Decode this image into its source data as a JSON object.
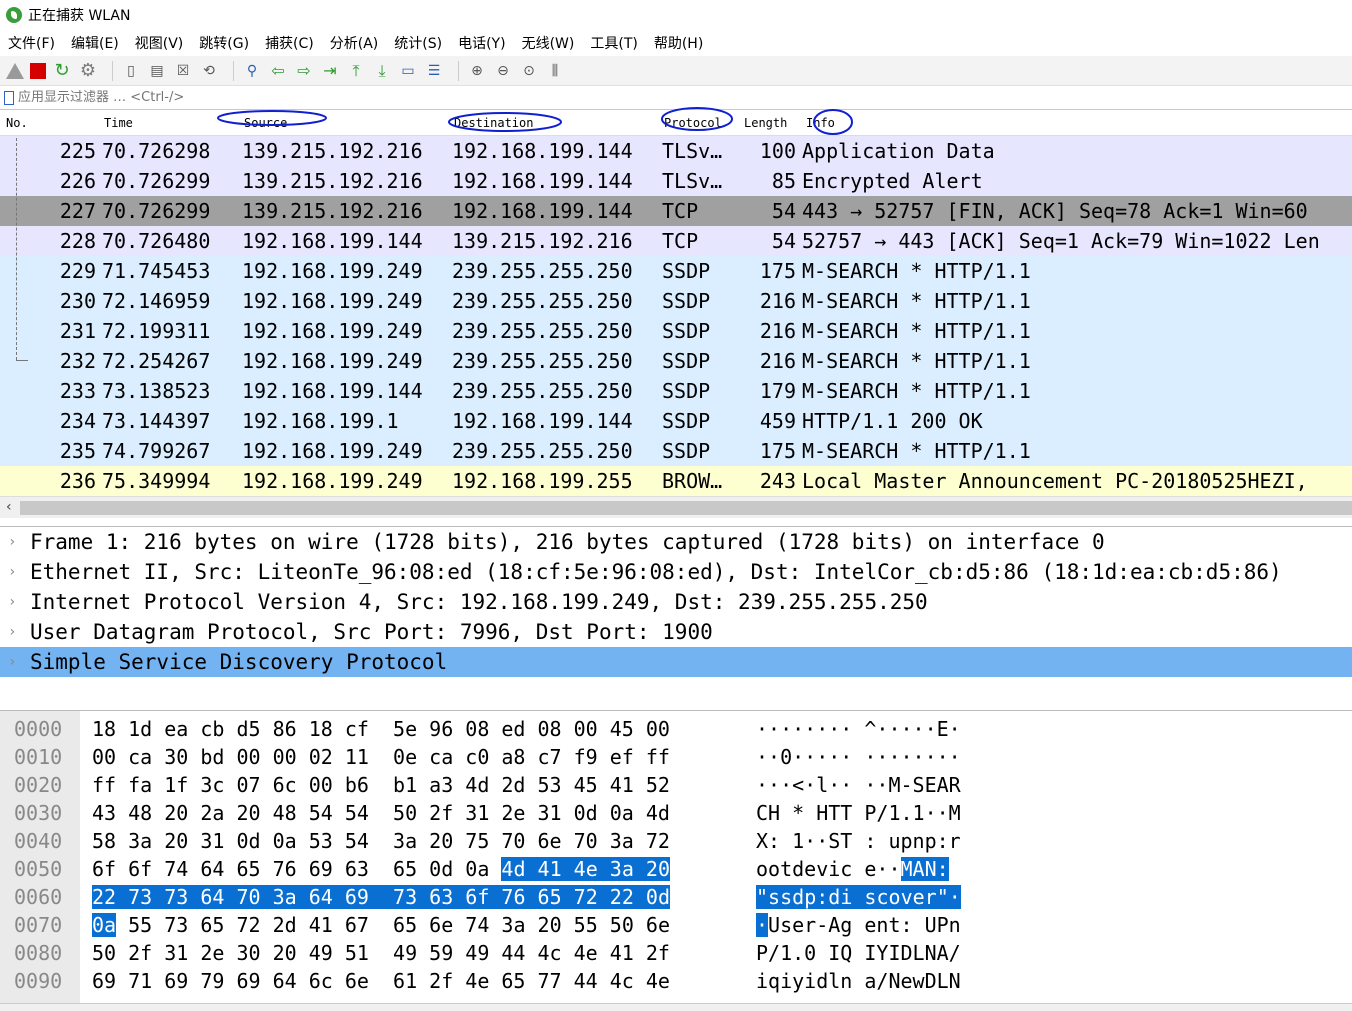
{
  "window": {
    "title": "正在捕获 WLAN"
  },
  "menu": [
    "文件(F)",
    "编辑(E)",
    "视图(V)",
    "跳转(G)",
    "捕获(C)",
    "分析(A)",
    "统计(S)",
    "电话(Y)",
    "无线(W)",
    "工具(T)",
    "帮助(H)"
  ],
  "filter": {
    "placeholder": "应用显示过滤器 … <Ctrl-/>"
  },
  "columns": {
    "no": "No.",
    "time": "Time",
    "source": "Source",
    "destination": "Destination",
    "protocol": "Protocol",
    "length": "Length",
    "info": "Info"
  },
  "packets": [
    {
      "no": "225",
      "time": "70.726298",
      "src": "139.215.192.216",
      "dst": "192.168.199.144",
      "proto": "TLSv…",
      "len": "100",
      "info": "Application Data",
      "bg": "#e7e6ff"
    },
    {
      "no": "226",
      "time": "70.726299",
      "src": "139.215.192.216",
      "dst": "192.168.199.144",
      "proto": "TLSv…",
      "len": "85",
      "info": "Encrypted Alert",
      "bg": "#e7e6ff"
    },
    {
      "no": "227",
      "time": "70.726299",
      "src": "139.215.192.216",
      "dst": "192.168.199.144",
      "proto": "TCP",
      "len": "54",
      "info": "443 → 52757 [FIN, ACK] Seq=78 Ack=1 Win=60",
      "bg": "#a0a0a0"
    },
    {
      "no": "228",
      "time": "70.726480",
      "src": "192.168.199.144",
      "dst": "139.215.192.216",
      "proto": "TCP",
      "len": "54",
      "info": "52757 → 443 [ACK] Seq=1 Ack=79 Win=1022 Len",
      "bg": "#e7e6ff"
    },
    {
      "no": "229",
      "time": "71.745453",
      "src": "192.168.199.249",
      "dst": "239.255.255.250",
      "proto": "SSDP",
      "len": "175",
      "info": "M-SEARCH * HTTP/1.1",
      "bg": "#daeeff"
    },
    {
      "no": "230",
      "time": "72.146959",
      "src": "192.168.199.249",
      "dst": "239.255.255.250",
      "proto": "SSDP",
      "len": "216",
      "info": "M-SEARCH * HTTP/1.1",
      "bg": "#daeeff"
    },
    {
      "no": "231",
      "time": "72.199311",
      "src": "192.168.199.249",
      "dst": "239.255.255.250",
      "proto": "SSDP",
      "len": "216",
      "info": "M-SEARCH * HTTP/1.1",
      "bg": "#daeeff"
    },
    {
      "no": "232",
      "time": "72.254267",
      "src": "192.168.199.249",
      "dst": "239.255.255.250",
      "proto": "SSDP",
      "len": "216",
      "info": "M-SEARCH * HTTP/1.1",
      "bg": "#daeeff"
    },
    {
      "no": "233",
      "time": "73.138523",
      "src": "192.168.199.144",
      "dst": "239.255.255.250",
      "proto": "SSDP",
      "len": "179",
      "info": "M-SEARCH * HTTP/1.1",
      "bg": "#daeeff"
    },
    {
      "no": "234",
      "time": "73.144397",
      "src": "192.168.199.1",
      "dst": "192.168.199.144",
      "proto": "SSDP",
      "len": "459",
      "info": "HTTP/1.1 200 OK",
      "bg": "#daeeff"
    },
    {
      "no": "235",
      "time": "74.799267",
      "src": "192.168.199.249",
      "dst": "239.255.255.250",
      "proto": "SSDP",
      "len": "175",
      "info": "M-SEARCH * HTTP/1.1",
      "bg": "#daeeff"
    },
    {
      "no": "236",
      "time": "75.349994",
      "src": "192.168.199.249",
      "dst": "192.168.199.255",
      "proto": "BROW…",
      "len": "243",
      "info": "Local Master Announcement PC-20180525HEZI,",
      "bg": "#feffd0"
    }
  ],
  "details": [
    {
      "text": "Frame 1: 216 bytes on wire (1728 bits), 216 bytes captured (1728 bits) on interface 0",
      "selected": false
    },
    {
      "text": "Ethernet II, Src: LiteonTe_96:08:ed (18:cf:5e:96:08:ed), Dst: IntelCor_cb:d5:86 (18:1d:ea:cb:d5:86)",
      "selected": false
    },
    {
      "text": "Internet Protocol Version 4, Src: 192.168.199.249, Dst: 239.255.255.250",
      "selected": false
    },
    {
      "text": "User Datagram Protocol, Src Port: 7996, Dst Port: 1900",
      "selected": false
    },
    {
      "text": "Simple Service Discovery Protocol",
      "selected": true
    }
  ],
  "bytes": [
    {
      "off": "0000",
      "hex": [
        "18",
        "1d",
        "ea",
        "cb",
        "d5",
        "86",
        "18",
        "cf",
        "5e",
        "96",
        "08",
        "ed",
        "08",
        "00",
        "45",
        "00"
      ],
      "ascii": "········ ^·····E·"
    },
    {
      "off": "0010",
      "hex": [
        "00",
        "ca",
        "30",
        "bd",
        "00",
        "00",
        "02",
        "11",
        "0e",
        "ca",
        "c0",
        "a8",
        "c7",
        "f9",
        "ef",
        "ff"
      ],
      "ascii": "··0····· ········"
    },
    {
      "off": "0020",
      "hex": [
        "ff",
        "fa",
        "1f",
        "3c",
        "07",
        "6c",
        "00",
        "b6",
        "b1",
        "a3",
        "4d",
        "2d",
        "53",
        "45",
        "41",
        "52"
      ],
      "ascii": "···<·l·· ··M-SEAR"
    },
    {
      "off": "0030",
      "hex": [
        "43",
        "48",
        "20",
        "2a",
        "20",
        "48",
        "54",
        "54",
        "50",
        "2f",
        "31",
        "2e",
        "31",
        "0d",
        "0a",
        "4d"
      ],
      "ascii": "CH * HTT P/1.1··M"
    },
    {
      "off": "0040",
      "hex": [
        "58",
        "3a",
        "20",
        "31",
        "0d",
        "0a",
        "53",
        "54",
        "3a",
        "20",
        "75",
        "70",
        "6e",
        "70",
        "3a",
        "72"
      ],
      "ascii": "X: 1··ST : upnp:r"
    },
    {
      "off": "0050",
      "hex": [
        "6f",
        "6f",
        "74",
        "64",
        "65",
        "76",
        "69",
        "63",
        "65",
        "0d",
        "0a",
        "4d",
        "41",
        "4e",
        "3a",
        "20"
      ],
      "ascii": "ootdevic e··MAN: "
    },
    {
      "off": "0060",
      "hex": [
        "22",
        "73",
        "73",
        "64",
        "70",
        "3a",
        "64",
        "69",
        "73",
        "63",
        "6f",
        "76",
        "65",
        "72",
        "22",
        "0d"
      ],
      "ascii": "\"ssdp:di scover\"·"
    },
    {
      "off": "0070",
      "hex": [
        "0a",
        "55",
        "73",
        "65",
        "72",
        "2d",
        "41",
        "67",
        "65",
        "6e",
        "74",
        "3a",
        "20",
        "55",
        "50",
        "6e"
      ],
      "ascii": "·User-Ag ent: UPn"
    },
    {
      "off": "0080",
      "hex": [
        "50",
        "2f",
        "31",
        "2e",
        "30",
        "20",
        "49",
        "51",
        "49",
        "59",
        "49",
        "44",
        "4c",
        "4e",
        "41",
        "2f"
      ],
      "ascii": "P/1.0 IQ IYIDLNA/"
    },
    {
      "off": "0090",
      "hex": [
        "69",
        "71",
        "69",
        "79",
        "69",
        "64",
        "6c",
        "6e",
        "61",
        "2f",
        "4e",
        "65",
        "77",
        "44",
        "4c",
        "4e"
      ],
      "ascii": "iqiyidln a/NewDLN"
    }
  ],
  "highlight": {
    "start": 91,
    "end": 112
  }
}
